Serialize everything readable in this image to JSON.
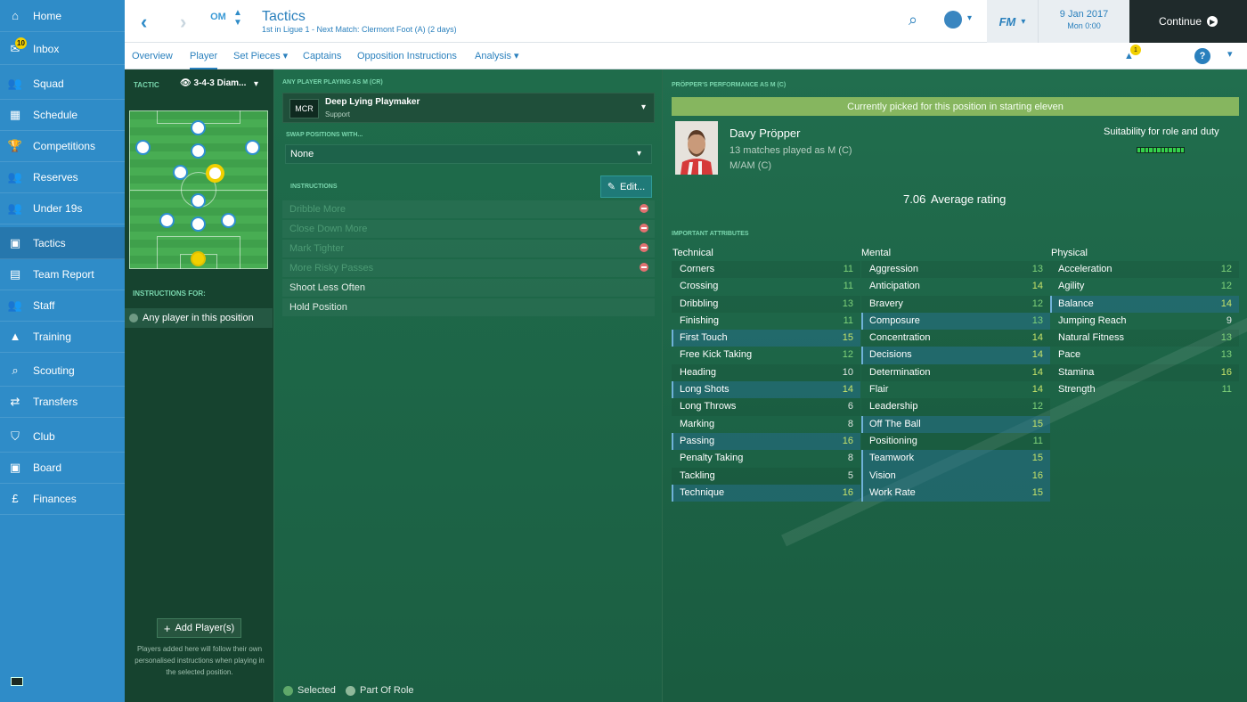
{
  "sidebar": {
    "items": [
      {
        "label": "Home",
        "icon": "home-icon"
      },
      {
        "label": "Inbox",
        "icon": "inbox-icon",
        "badge": "10"
      },
      {
        "label": "Squad",
        "icon": "squad-icon"
      },
      {
        "label": "Schedule",
        "icon": "schedule-icon"
      },
      {
        "label": "Competitions",
        "icon": "trophy-icon"
      },
      {
        "label": "Reserves",
        "icon": "reserves-icon"
      },
      {
        "label": "Under 19s",
        "icon": "under19-icon"
      },
      {
        "label": "Tactics",
        "icon": "tactics-icon",
        "active": true
      },
      {
        "label": "Team Report",
        "icon": "report-icon"
      },
      {
        "label": "Staff",
        "icon": "staff-icon"
      },
      {
        "label": "Training",
        "icon": "training-icon"
      },
      {
        "label": "Scouting",
        "icon": "scouting-icon"
      },
      {
        "label": "Transfers",
        "icon": "transfers-icon"
      },
      {
        "label": "Club",
        "icon": "club-icon"
      },
      {
        "label": "Board",
        "icon": "board-icon"
      },
      {
        "label": "Finances",
        "icon": "finances-icon"
      }
    ]
  },
  "header": {
    "title": "Tactics",
    "subtitle": "1st in Ligue 1 - Next Match: Clermont Foot (A) (2 days)",
    "club_badge": "OM",
    "fm_label": "FM",
    "date": "9 Jan 2017",
    "time": "Mon 0:00",
    "continue_label": "Continue"
  },
  "subtabs": {
    "items": [
      "Overview",
      "Player",
      "Set Pieces",
      "Captains",
      "Opposition Instructions",
      "Analysis"
    ],
    "active": "Player",
    "notification_count": "1"
  },
  "tactic": {
    "label": "TACTIC",
    "name": "3-4-3 Diam..."
  },
  "instructions_for": {
    "label": "INSTRUCTIONS FOR:",
    "item": "Any player in this position"
  },
  "add_player": {
    "label": "Add Player(s)",
    "note": "Players added here will follow their own personalised instructions when playing in the selected position."
  },
  "role": {
    "section_label": "ANY PLAYER PLAYING AS M (CR)",
    "abbr": "MCR",
    "name": "Deep Lying Playmaker",
    "duty": "Support"
  },
  "swap": {
    "section_label": "SWAP POSITIONS WITH...",
    "value": "None"
  },
  "instructions": {
    "section_label": "INSTRUCTIONS",
    "edit_label": "Edit...",
    "items": [
      {
        "label": "Dribble More",
        "state": "disabled"
      },
      {
        "label": "Close Down More",
        "state": "disabled"
      },
      {
        "label": "Mark Tighter",
        "state": "disabled"
      },
      {
        "label": "More Risky Passes",
        "state": "disabled"
      },
      {
        "label": "Shoot Less Often",
        "state": "enabled"
      },
      {
        "label": "Hold Position",
        "state": "enabled"
      }
    ]
  },
  "legend": {
    "selected": "Selected",
    "part_of_role": "Part Of Role",
    "selected_color": "#5fa86a",
    "part_of_role_color": "#8fb89a"
  },
  "performance": {
    "section_label": "PRÖPPER'S PERFORMANCE AS M (C)",
    "picked_text": "Currently picked for this position in starting eleven",
    "player_name": "Davy Pröpper",
    "matches": "13 matches played as M (C)",
    "positions": "M/AM (C)",
    "suitability_label": "Suitability for role and duty",
    "suitability_level": 1.0,
    "avg_rating": "7.06",
    "avg_rating_label": "Average rating"
  },
  "attributes": {
    "section_label": "IMPORTANT ATTRIBUTES",
    "technical_header": "Technical",
    "mental_header": "Mental",
    "physical_header": "Physical",
    "technical": [
      {
        "name": "Corners",
        "value": "11",
        "key": false
      },
      {
        "name": "Crossing",
        "value": "11",
        "key": false
      },
      {
        "name": "Dribbling",
        "value": "13",
        "key": false
      },
      {
        "name": "Finishing",
        "value": "11",
        "key": false
      },
      {
        "name": "First Touch",
        "value": "15",
        "key": true
      },
      {
        "name": "Free Kick Taking",
        "value": "12",
        "key": false
      },
      {
        "name": "Heading",
        "value": "10",
        "key": false
      },
      {
        "name": "Long Shots",
        "value": "14",
        "key": true
      },
      {
        "name": "Long Throws",
        "value": "6",
        "key": false
      },
      {
        "name": "Marking",
        "value": "8",
        "key": false
      },
      {
        "name": "Passing",
        "value": "16",
        "key": true
      },
      {
        "name": "Penalty Taking",
        "value": "8",
        "key": false
      },
      {
        "name": "Tackling",
        "value": "5",
        "key": false
      },
      {
        "name": "Technique",
        "value": "16",
        "key": true
      }
    ],
    "mental": [
      {
        "name": "Aggression",
        "value": "13",
        "key": false
      },
      {
        "name": "Anticipation",
        "value": "14",
        "key": false
      },
      {
        "name": "Bravery",
        "value": "12",
        "key": false
      },
      {
        "name": "Composure",
        "value": "13",
        "key": true
      },
      {
        "name": "Concentration",
        "value": "14",
        "key": false
      },
      {
        "name": "Decisions",
        "value": "14",
        "key": true
      },
      {
        "name": "Determination",
        "value": "14",
        "key": false
      },
      {
        "name": "Flair",
        "value": "14",
        "key": false
      },
      {
        "name": "Leadership",
        "value": "12",
        "key": false
      },
      {
        "name": "Off The Ball",
        "value": "15",
        "key": true
      },
      {
        "name": "Positioning",
        "value": "11",
        "key": false
      },
      {
        "name": "Teamwork",
        "value": "15",
        "key": true
      },
      {
        "name": "Vision",
        "value": "16",
        "key": true
      },
      {
        "name": "Work Rate",
        "value": "15",
        "key": true
      }
    ],
    "physical": [
      {
        "name": "Acceleration",
        "value": "12",
        "key": false
      },
      {
        "name": "Agility",
        "value": "12",
        "key": false
      },
      {
        "name": "Balance",
        "value": "14",
        "key": true
      },
      {
        "name": "Jumping Reach",
        "value": "9",
        "key": false
      },
      {
        "name": "Natural Fitness",
        "value": "13",
        "key": false
      },
      {
        "name": "Pace",
        "value": "13",
        "key": false
      },
      {
        "name": "Stamina",
        "value": "16",
        "key": false
      },
      {
        "name": "Strength",
        "value": "11",
        "key": false
      }
    ]
  }
}
